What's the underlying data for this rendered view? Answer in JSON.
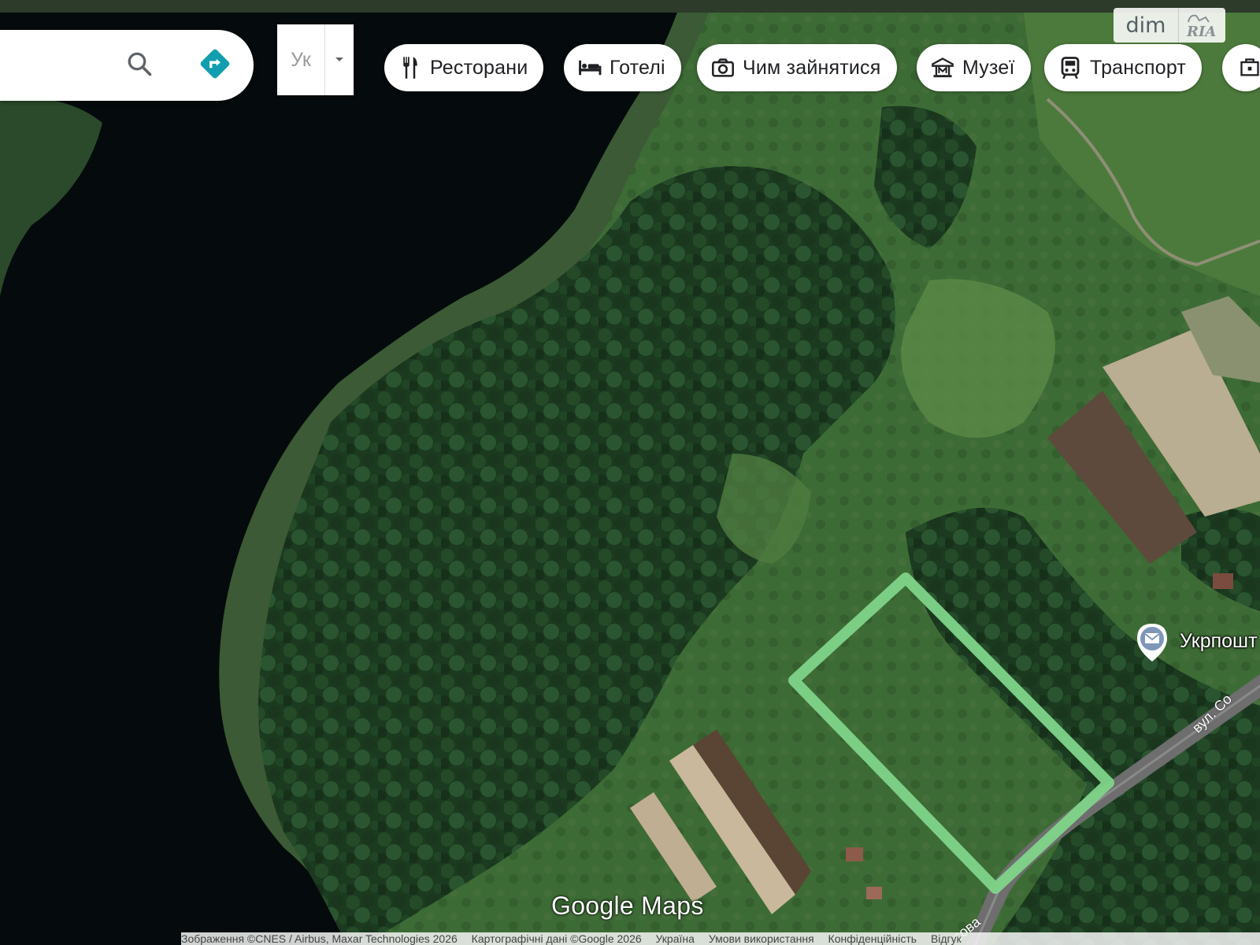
{
  "search": {
    "placeholder": "",
    "search_icon": "search-icon",
    "directions_icon": "directions-icon",
    "accent_color": "#129eaf"
  },
  "language": {
    "value": "Ук",
    "arrow_icon": "dropdown-arrow-icon"
  },
  "categories": [
    {
      "label": "Ресторани",
      "icon": "restaurant-icon"
    },
    {
      "label": "Готелі",
      "icon": "hotel-icon"
    },
    {
      "label": "Чим зайнятися",
      "icon": "camera-icon"
    },
    {
      "label": "Музеї",
      "icon": "museum-icon"
    },
    {
      "label": "Транспорт",
      "icon": "transit-icon"
    },
    {
      "label": "",
      "icon": "more-places-icon"
    }
  ],
  "watermark": {
    "brand_text": "dim",
    "ria_mark": "RIA"
  },
  "map": {
    "type": "satellite",
    "parcel_outline_color": "#7fd48a",
    "poi": {
      "label": "Укрпошт",
      "icon": "mail-icon"
    },
    "street_labels": [
      "вул. Со",
      "сова"
    ],
    "logo": "Google Maps"
  },
  "attribution": {
    "imagery": "Зображення ©CNES / Airbus, Maxar Technologies 2026",
    "map_data": "Картографічні дані ©Google 2026",
    "country": "Україна",
    "terms": "Умови використання",
    "privacy": "Конфіденційність",
    "feedback": "Відгук"
  }
}
